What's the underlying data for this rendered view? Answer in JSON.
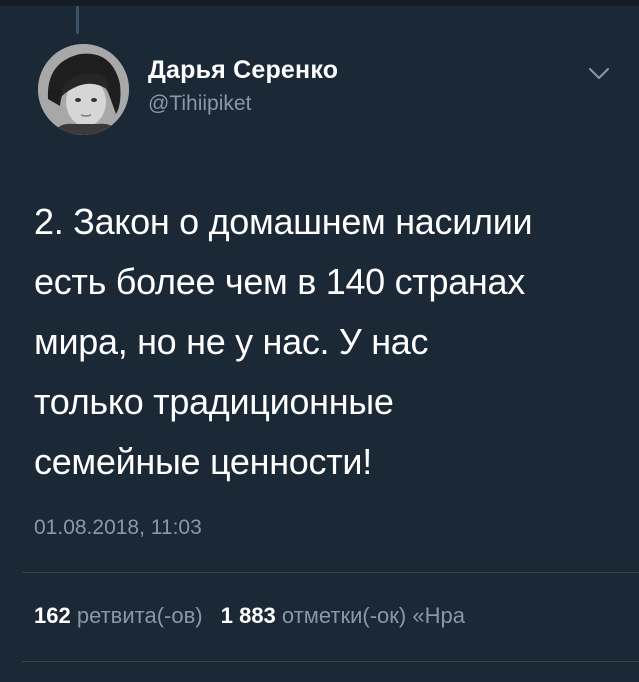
{
  "tweet": {
    "author": {
      "name": "Дарья Серенко",
      "handle": "@Tihiipiket"
    },
    "text": "2. Закон о домашнем насилии\nесть более чем в 140 странах\nмира, но не у нас. У нас\nтолько традиционные\nсемейные ценности!",
    "timestamp": "01.08.2018, 11:03",
    "stats": {
      "retweets_count": "162",
      "retweets_label": "ретвита(-ов)",
      "likes_count": "1 883",
      "likes_label": "отметки(-ок)",
      "extra_label": "«Нра"
    }
  },
  "icons": {
    "caret": "chevron-down-icon",
    "avatar": "user-avatar"
  },
  "colors": {
    "background": "#1b2836",
    "text": "#ffffff",
    "secondary_text": "#8899a6",
    "divider": "#38444d"
  }
}
